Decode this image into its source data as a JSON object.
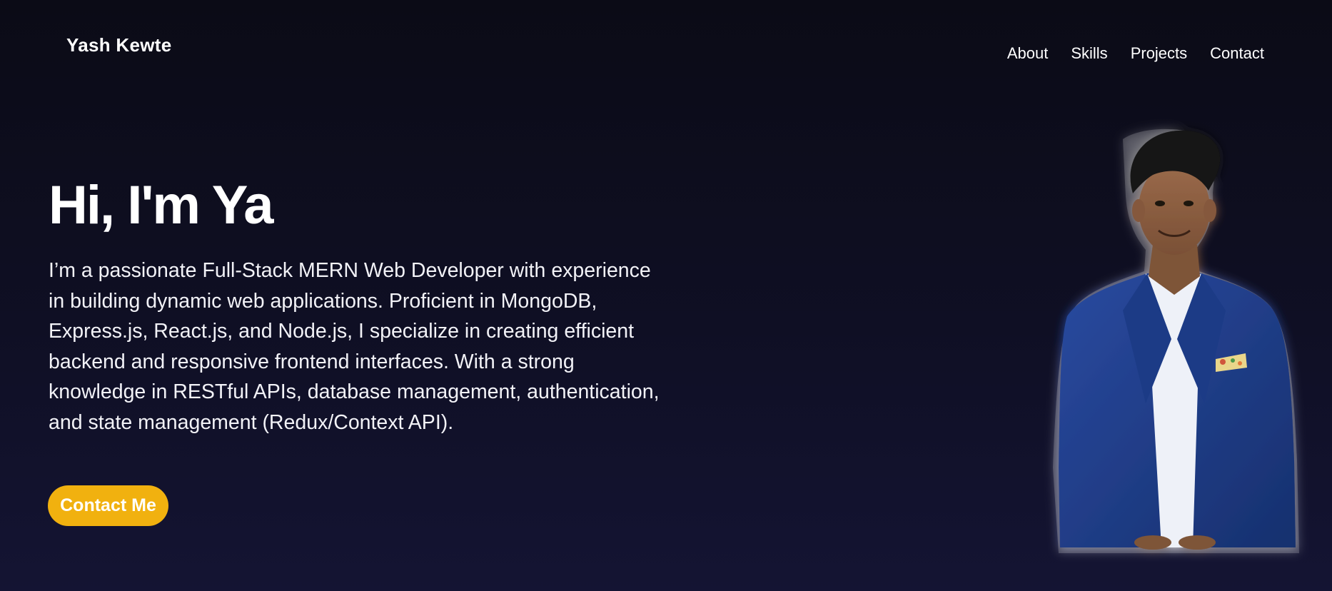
{
  "navbar": {
    "brand": "Yash Kewte",
    "links": [
      {
        "label": "About"
      },
      {
        "label": "Skills"
      },
      {
        "label": "Projects"
      },
      {
        "label": "Contact"
      }
    ]
  },
  "hero": {
    "title": "Hi, I'm Ya",
    "description": "I’m a passionate Full-Stack MERN Web Developer with experience in building dynamic web applications. Proficient in MongoDB, Express.js, React.js, and Node.js, I specialize in creating efficient backend and responsive frontend interfaces. With a strong knowledge in RESTful APIs, database management, authentication, and state management (Redux/Context API).",
    "cta_label": "Contact Me"
  },
  "colors": {
    "background": "#0d0d1c",
    "accent": "#f1b10f",
    "text": "#ffffff"
  }
}
